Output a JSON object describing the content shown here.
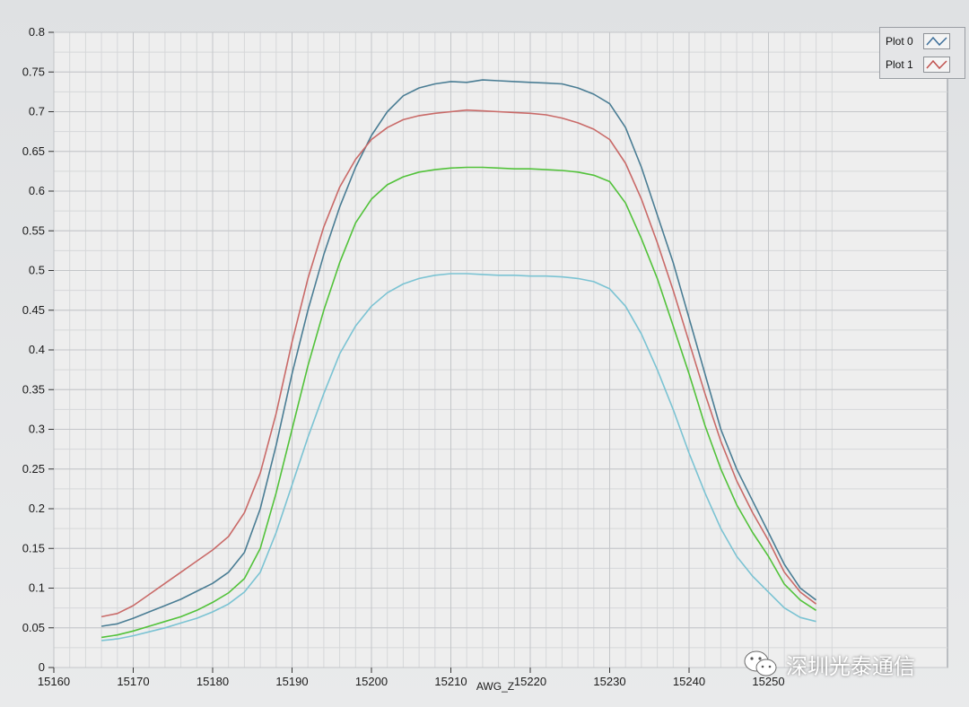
{
  "chart_data": {
    "type": "line",
    "xlabel": "AWG_Z",
    "ylabel": "",
    "xlim": [
      15160,
      15250
    ],
    "ylim": [
      0,
      0.8
    ],
    "x_ticks": [
      "15160",
      "15170",
      "15180",
      "15190",
      "15200",
      "15210",
      "15220",
      "15230",
      "15240",
      "15250"
    ],
    "y_ticks": [
      "0",
      "0.05",
      "0.1",
      "0.15",
      "0.2",
      "0.25",
      "0.3",
      "0.35",
      "0.4",
      "0.45",
      "0.5",
      "0.55",
      "0.6",
      "0.65",
      "0.7",
      "0.75",
      "0.8"
    ],
    "grid": true,
    "legend_position": "top-right",
    "x": [
      15166,
      15168,
      15170,
      15172,
      15174,
      15176,
      15178,
      15180,
      15182,
      15184,
      15186,
      15188,
      15190,
      15192,
      15194,
      15196,
      15198,
      15200,
      15202,
      15204,
      15206,
      15208,
      15210,
      15212,
      15214,
      15216,
      15218,
      15220,
      15222,
      15224,
      15226,
      15228,
      15230,
      15232,
      15234,
      15236,
      15238,
      15240,
      15242,
      15244,
      15246,
      15248,
      15250,
      15252,
      15254,
      15256
    ],
    "series": [
      {
        "name": "Plot 0",
        "color": "#4a7d94",
        "values": [
          0.052,
          0.055,
          0.062,
          0.07,
          0.078,
          0.086,
          0.096,
          0.106,
          0.12,
          0.145,
          0.2,
          0.28,
          0.37,
          0.45,
          0.52,
          0.58,
          0.63,
          0.67,
          0.7,
          0.72,
          0.73,
          0.735,
          0.738,
          0.737,
          0.74,
          0.739,
          0.738,
          0.737,
          0.736,
          0.735,
          0.73,
          0.722,
          0.71,
          0.68,
          0.63,
          0.57,
          0.51,
          0.44,
          0.37,
          0.3,
          0.25,
          0.21,
          0.17,
          0.13,
          0.1,
          0.085
        ]
      },
      {
        "name": "Plot 1",
        "color": "#c96a68",
        "values": [
          0.064,
          0.068,
          0.078,
          0.092,
          0.106,
          0.12,
          0.134,
          0.148,
          0.165,
          0.195,
          0.245,
          0.32,
          0.41,
          0.49,
          0.555,
          0.605,
          0.64,
          0.665,
          0.68,
          0.69,
          0.695,
          0.698,
          0.7,
          0.702,
          0.701,
          0.7,
          0.699,
          0.698,
          0.696,
          0.692,
          0.686,
          0.678,
          0.665,
          0.635,
          0.59,
          0.535,
          0.475,
          0.41,
          0.345,
          0.285,
          0.235,
          0.195,
          0.16,
          0.12,
          0.095,
          0.08
        ]
      },
      {
        "name": "",
        "color": "#52c23a",
        "values": [
          0.038,
          0.041,
          0.046,
          0.052,
          0.058,
          0.064,
          0.072,
          0.082,
          0.094,
          0.112,
          0.15,
          0.22,
          0.3,
          0.38,
          0.45,
          0.51,
          0.56,
          0.59,
          0.608,
          0.618,
          0.624,
          0.627,
          0.629,
          0.63,
          0.63,
          0.629,
          0.628,
          0.628,
          0.627,
          0.626,
          0.624,
          0.62,
          0.612,
          0.585,
          0.54,
          0.49,
          0.43,
          0.37,
          0.305,
          0.25,
          0.205,
          0.17,
          0.14,
          0.105,
          0.085,
          0.072
        ]
      },
      {
        "name": "",
        "color": "#7bc3d3",
        "values": [
          0.034,
          0.036,
          0.04,
          0.045,
          0.05,
          0.056,
          0.062,
          0.07,
          0.08,
          0.095,
          0.12,
          0.17,
          0.23,
          0.29,
          0.345,
          0.395,
          0.43,
          0.455,
          0.472,
          0.483,
          0.49,
          0.494,
          0.496,
          0.496,
          0.495,
          0.494,
          0.494,
          0.493,
          0.493,
          0.492,
          0.49,
          0.486,
          0.477,
          0.455,
          0.42,
          0.375,
          0.325,
          0.27,
          0.22,
          0.175,
          0.14,
          0.115,
          0.095,
          0.075,
          0.063,
          0.058
        ]
      }
    ]
  },
  "legend": {
    "items": [
      {
        "label": "Plot 0",
        "icon": "line-sample-icon",
        "color": "#3d6f9a"
      },
      {
        "label": "Plot 1",
        "icon": "line-sample-icon",
        "color": "#c0504d"
      }
    ]
  },
  "watermark": {
    "icon": "wechat-icon",
    "text": "深圳光泰通信"
  }
}
